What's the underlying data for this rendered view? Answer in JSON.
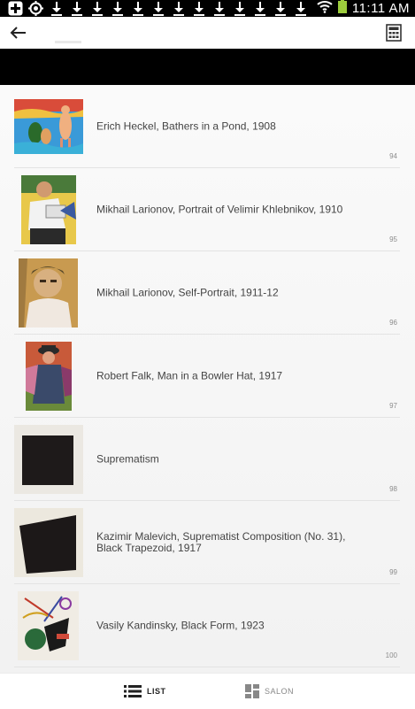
{
  "status_bar": {
    "time": "11:11 AM"
  },
  "app_bar": {
    "back_icon": "arrow-left-icon",
    "menu_icon": "calculator-grid-icon"
  },
  "artworks": [
    {
      "title": "Erich Heckel, Bathers in a Pond, 1908",
      "number": "94"
    },
    {
      "title": "Mikhail Larionov, Portrait of Velimir Khlebnikov, 1910",
      "number": "95"
    },
    {
      "title": "Mikhail Larionov, Self-Portrait, 1911-12",
      "number": "96"
    },
    {
      "title": "Robert Falk, Man in a Bowler Hat, 1917",
      "number": "97"
    },
    {
      "title": "Suprematism",
      "number": "98"
    },
    {
      "title": "Kazimir Malevich, Suprematist Composition (No. 31), Black Trapezoid, 1917",
      "number": "99"
    },
    {
      "title": "Vasily Kandinsky, Black Form, 1923",
      "number": "100"
    }
  ],
  "bottom_bar": {
    "list_label": "LIST",
    "salon_label": "SALON"
  }
}
